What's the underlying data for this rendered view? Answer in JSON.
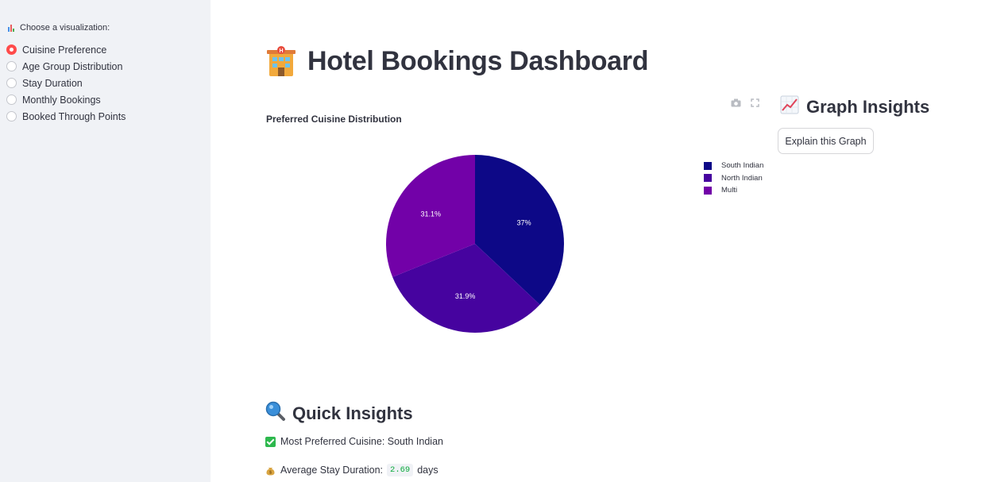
{
  "sidebar": {
    "label": "Choose a visualization:",
    "options": [
      {
        "label": "Cuisine Preference",
        "selected": true
      },
      {
        "label": "Age Group Distribution",
        "selected": false
      },
      {
        "label": "Stay Duration",
        "selected": false
      },
      {
        "label": "Monthly Bookings",
        "selected": false
      },
      {
        "label": "Booked Through Points",
        "selected": false
      }
    ]
  },
  "header": {
    "title": "Hotel Bookings Dashboard",
    "icon": "hotel-icon"
  },
  "chart_data": {
    "type": "pie",
    "title": "Preferred Cuisine Distribution",
    "categories": [
      "South Indian",
      "North Indian",
      "Multi"
    ],
    "values": [
      37,
      31.9,
      31.1
    ],
    "labels": [
      "37%",
      "31.9%",
      "31.1%"
    ],
    "colors": [
      "#0d0887",
      "#46039f",
      "#7201a8"
    ],
    "legend_position": "right",
    "text_color": "#ffffff"
  },
  "modebar": {
    "icons": [
      "camera-icon",
      "fullscreen-icon"
    ]
  },
  "graph_insights": {
    "title": "Graph Insights",
    "button_label": "Explain this Graph"
  },
  "quick_insights": {
    "title": "Quick Insights",
    "preferred_cuisine_text": "Most Preferred Cuisine: South Indian",
    "avg_stay_prefix": "Average Stay Duration:",
    "avg_stay_value": "2.69",
    "avg_stay_suffix": "days"
  },
  "colors": {
    "accent": "#ff4b4b",
    "sidebar_bg": "#f0f2f6",
    "text": "#31333f",
    "success": "#2db84d",
    "code_text": "#09ab3b"
  }
}
